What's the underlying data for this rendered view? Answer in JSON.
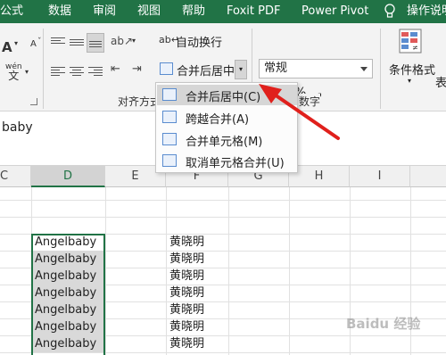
{
  "tabs": [
    "公式",
    "数据",
    "审阅",
    "视图",
    "帮助",
    "Foxit PDF",
    "Power Pivot",
    "操作说明"
  ],
  "ribbon": {
    "wrap_text": "自动换行",
    "merge_center": "合并后居中",
    "number_format": "常规",
    "conditional_format": "条件格式",
    "table_format_partial": "表",
    "percent_symbol": "%",
    "comma_symbol": ",",
    "align_group_label": "对齐方式",
    "number_group_label": "数字",
    "font_icon_text": "wén"
  },
  "formula_bar": {
    "value": "baby"
  },
  "columns": [
    "C",
    "D",
    "E",
    "F",
    "G",
    "H",
    "I"
  ],
  "merge_menu": {
    "items": [
      {
        "label": "合并后居中(C)",
        "highlighted": true
      },
      {
        "label": "跨越合并(A)",
        "highlighted": false
      },
      {
        "label": "合并单元格(M)",
        "highlighted": false
      },
      {
        "label": "取消单元格合并(U)",
        "highlighted": false
      }
    ]
  },
  "cells_d": [
    "Angelbaby",
    "Angelbaby",
    "Angelbaby",
    "Angelbaby",
    "Angelbaby",
    "Angelbaby",
    "Angelbaby"
  ],
  "cells_f": [
    "黄晓明",
    "黄晓明",
    "黄晓明",
    "黄晓明",
    "黄晓明",
    "黄晓明",
    "黄晓明"
  ],
  "colors": {
    "excel_green": "#217346",
    "arrow_red": "#e0201c",
    "selection_shade": "#d9d9d9"
  },
  "watermark": "Baidu 经验"
}
